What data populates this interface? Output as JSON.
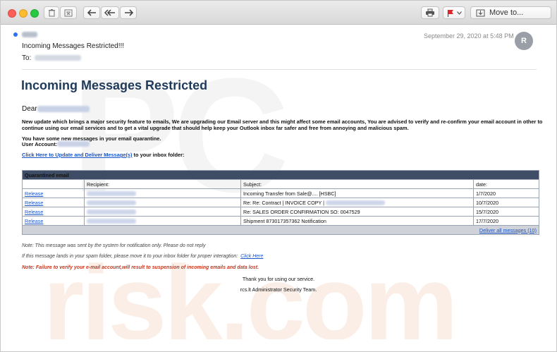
{
  "toolbar": {
    "move_label": "Move to..."
  },
  "message": {
    "subject": "Incoming Messages Restricted!!!",
    "to_label": "To:",
    "date": "September 29, 2020 at 5:48 PM",
    "avatar_initial": "R"
  },
  "body": {
    "heading": "Incoming Messages Restricted",
    "greeting": "Dear",
    "paragraph": "New update which brings a major security feature to emails, We are upgrading our Email server and this might affect some email accounts, You are advised to verify and re-confirm your email account in other to continue using our email services and  to get a vital upgrade that should help keep your Outlook inbox far safer and free from annoying and malicious spam.",
    "quarantine_line": "You have some new messages in your email quarantine.",
    "account_label": "User Account:",
    "link_text": "Click Here to Update and Deliver Message(s)",
    "link_suffix": " to your inbox folder:"
  },
  "table": {
    "title": "Quarantined email",
    "headers": [
      "",
      "Recipient:",
      "Subject:",
      "date:"
    ],
    "rows": [
      {
        "action": "Release",
        "subject": "Incoming Transfer from Sale@.... [HSBC]",
        "date": "1/7/2020"
      },
      {
        "action": "Release",
        "subject": "Re: Re: Contract | INVOICE COPY |",
        "date": "10/7/2020"
      },
      {
        "action": "Release",
        "subject": "Re: SALES ORDER CONFIRMATION SO: 0047529",
        "date": "15/7/2020"
      },
      {
        "action": "Release",
        "subject": "Shipment 873017357362 Notification",
        "date": "17/7/2020"
      }
    ],
    "deliver_all": "Deliver all messages (10)"
  },
  "notes": {
    "note1": "Note: This message was sent by the system for notification only. Please do not reply",
    "note2": "If this message lands in your spam folder, please move it to your inbox folder for proper interagtion:",
    "note2_link": "Click Here",
    "warning": "Note: Failure to verify your e-mail account,will result to suspension of incoming emails and data lost.",
    "thanks": "Thank you for using our service.",
    "signature": "rcs.lt Administrator Security Team."
  },
  "colors": {
    "heading": "#1f3a5a",
    "link": "#1a55c9",
    "table_header": "#3e4c65",
    "warning": "#c9361c"
  }
}
